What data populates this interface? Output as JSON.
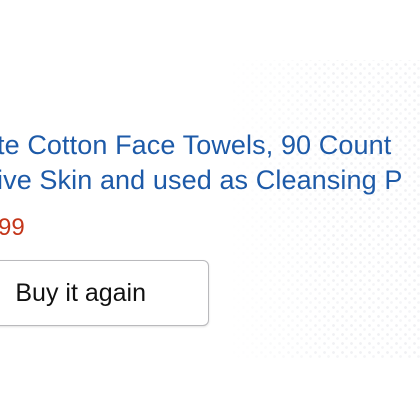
{
  "product": {
    "title_line_1": "te Cotton Face Towels, 90 Count",
    "title_line_2": "ive Skin and used as Cleansing P",
    "price": "99"
  },
  "actions": {
    "buy_again_label": "Buy it again"
  }
}
